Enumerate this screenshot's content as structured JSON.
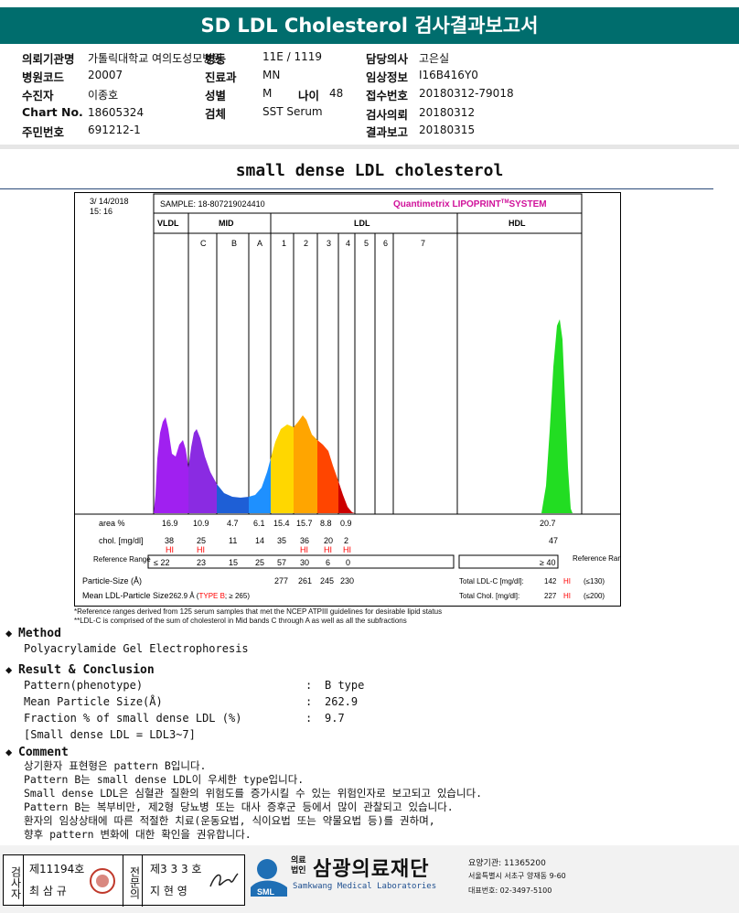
{
  "header": {
    "title": "SD LDL Cholesterol 검사결과보고서"
  },
  "info": [
    {
      "label": "의뢰기관명",
      "value": "가톨릭대학교 여의도성모병원"
    },
    {
      "label": "병동",
      "value": "11E / 1119"
    },
    {
      "label": "담당의사",
      "value": "고은실"
    },
    {
      "label": "병원코드",
      "value": "20007"
    },
    {
      "label": "진료과",
      "value": "MN"
    },
    {
      "label": "임상정보",
      "value": "I16B416Y0"
    },
    {
      "label": "수진자",
      "value": "이종호"
    },
    {
      "label": "성별",
      "value": "M"
    },
    {
      "label": "나이",
      "value": "48"
    },
    {
      "label": "접수번호",
      "value": "20180312-79018"
    },
    {
      "label": "Chart No.",
      "value": "18605324"
    },
    {
      "label": "검체",
      "value": "SST Serum"
    },
    {
      "label": "검사의뢰",
      "value": "20180312"
    },
    {
      "label": "주민번호",
      "value": "691212-1"
    },
    {
      "label": "결과보고",
      "value": "20180315"
    }
  ],
  "subtitle": "small dense LDL cholesterol",
  "chart_data": {
    "type": "area",
    "date": "3/ 14/2018",
    "time": "15: 16",
    "sample": "SAMPLE:  18-807219024410",
    "system": "Quantimetrix LIPOPRINT",
    "system_tm": "TM",
    "system_suffix": "SYSTEM",
    "groups": [
      "VLDL",
      "MID",
      "LDL",
      "HDL"
    ],
    "bands": [
      "C",
      "B",
      "A",
      "1",
      "2",
      "3",
      "4",
      "5",
      "6",
      "7"
    ],
    "row_labels": {
      "area": "area %",
      "chol": "chol. [mg/dl]",
      "ref": "Reference Range",
      "size": "Particle-Size (Å)",
      "mean": "Mean LDL-Particle Size:"
    },
    "area_pct": [
      "16.9",
      "10.9",
      "4.7",
      "6.1",
      "15.4",
      "15.7",
      "8.8",
      "0.9",
      "20.7"
    ],
    "chol": [
      "38",
      "25",
      "11",
      "14",
      "35",
      "36",
      "20",
      "2",
      "47"
    ],
    "hi_flags": [
      "HI",
      "HI",
      "HI",
      "HI",
      "HI"
    ],
    "ref_range": [
      "≤ 22",
      "23",
      "15",
      "25",
      "57",
      "30",
      "6",
      "0"
    ],
    "hdl_ref": "≥ 40",
    "ref_right": "Reference Range",
    "particle_size": [
      "277",
      "261",
      "245",
      "230"
    ],
    "mean_size": "262.9 Å (",
    "mean_type": "TYPE B",
    "mean_suffix": "; ≥ 265)",
    "total_ldl_label": "Total LDL-C [mg/dl]:",
    "total_ldl_value": "142",
    "total_ldl_flag": "HI",
    "total_ldl_ref": "(≤130)",
    "total_chol_label": "Total Chol. [mg/dl]:",
    "total_chol_value": "227",
    "total_chol_flag": "HI",
    "total_chol_ref": "(≤200)",
    "colors": {
      "VLDL": "#a020f0",
      "MID_C": "#8a2be2",
      "MID_B": "#1e5fd6",
      "MID_A": "#1e90ff",
      "LDL1": "#ffd700",
      "LDL2": "#ffa500",
      "LDL3": "#ff4500",
      "LDL4": "#cc0000",
      "HDL": "#22dd22",
      "flag": "#ff0000",
      "title": "#d0119a"
    }
  },
  "footnotes": [
    "*Reference ranges derived from 125 serum samples that met the NCEP ATPIII guidelines for desirable lipid status",
    "**LDL-C is comprised of the sum of cholesterol in Mid bands C through A as well as all the subfractions"
  ],
  "method": {
    "head": "Method",
    "text": "Polyacrylamide Gel Electrophoresis"
  },
  "result": {
    "head": "Result & Conclusion",
    "rows": [
      {
        "label": "Pattern(phenotype)",
        "sep": ":",
        "value": "B type"
      },
      {
        "label": "Mean Particle Size(Å)",
        "sep": ":",
        "value": "262.9"
      },
      {
        "label": "Fraction % of small dense LDL (%)",
        "sep": ":",
        "value": "9.7"
      }
    ],
    "note": "[Small dense LDL = LDL3~7]"
  },
  "comment": {
    "head": "Comment",
    "lines": [
      "상기환자 표현형은 pattern B입니다.",
      "Pattern B는 small dense LDL이 우세한 type입니다.",
      "Small dense LDL은 심혈관 질환의 위험도를 증가시킬 수 있는 위험인자로 보고되고 있습니다.",
      "Pattern B는 복부비만, 제2형 당뇨병 또는 대사 증후군 등에서 많이 관찰되고 있습니다.",
      "환자의 임상상태에 따른 적절한 치료(운동요법, 식이요법 또는 약물요법 등)를 권하며,",
      "향후 pattern 변화에 대한 확인을 권유합니다."
    ]
  },
  "footer": {
    "exam_label": "검사자",
    "exam_no": "제11194호",
    "exam_name": "최 삼 규",
    "spec_label": "전문의",
    "spec_no": "제3 3 3 호",
    "spec_name": "지 현 영",
    "org_prefix_1": "의료",
    "org_prefix_2": "법인",
    "org_name": "삼광의료재단",
    "org_en": "Samkwang Medical Laboratories",
    "sml": "SML",
    "code": "요양기관: 11365200",
    "address": "서울특별시 서초구 양재동 9-60",
    "phone": "대표번호: 02-3497-5100"
  }
}
